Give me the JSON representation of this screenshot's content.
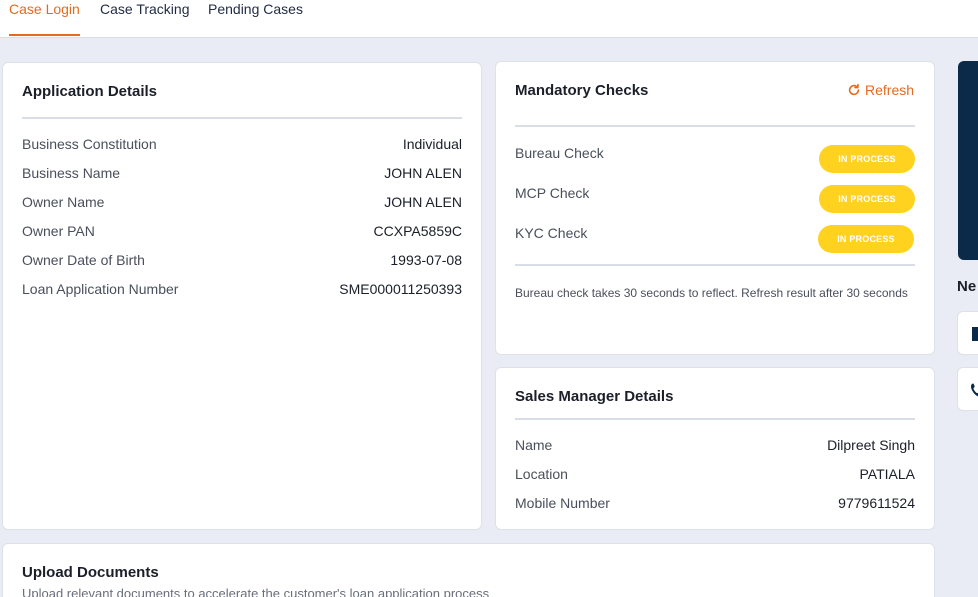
{
  "nav": {
    "tabs": [
      "Case Login",
      "Case Tracking",
      "Pending Cases"
    ]
  },
  "application": {
    "title": "Application Details",
    "rows": [
      {
        "label": "Business Constitution",
        "value": "Individual"
      },
      {
        "label": "Business Name",
        "value": "JOHN ALEN"
      },
      {
        "label": "Owner Name",
        "value": "JOHN ALEN"
      },
      {
        "label": "Owner PAN",
        "value": "CCXPA5859C"
      },
      {
        "label": "Owner Date of Birth",
        "value": "1993-07-08"
      },
      {
        "label": "Loan Application Number",
        "value": "SME000011250393"
      }
    ]
  },
  "mandatory": {
    "title": "Mandatory Checks",
    "refresh_label": "Refresh",
    "checks": [
      {
        "label": "Bureau Check",
        "status": "IN PROCESS"
      },
      {
        "label": "MCP Check",
        "status": "IN PROCESS"
      },
      {
        "label": "KYC Check",
        "status": "IN PROCESS"
      }
    ],
    "note": "Bureau check takes 30 seconds to reflect. Refresh result after 30 seconds"
  },
  "sales": {
    "title": "Sales Manager Details",
    "rows": [
      {
        "label": "Name",
        "value": "Dilpreet Singh"
      },
      {
        "label": "Location",
        "value": "PATIALA"
      },
      {
        "label": "Mobile Number",
        "value": "9779611524"
      }
    ]
  },
  "side": {
    "heading": "Ne"
  },
  "upload": {
    "title": "Upload Documents",
    "subtitle": "Upload relevant documents to accelerate the customer's loan application process"
  },
  "colors": {
    "accent": "#e46a1f",
    "badge": "#ffd21f",
    "navy": "#0b2a4a"
  }
}
